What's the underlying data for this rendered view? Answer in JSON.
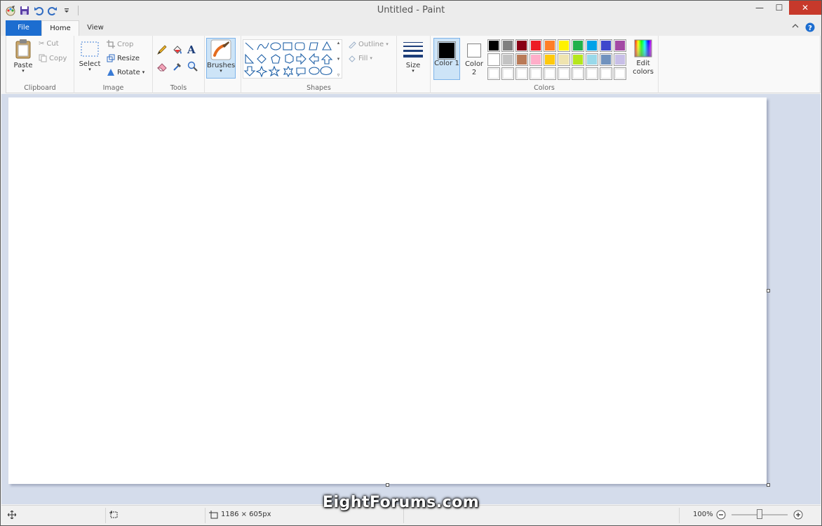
{
  "window": {
    "title": "Untitled - Paint",
    "minimize": "—",
    "maximize": "☐",
    "close": "✕"
  },
  "tabs": [
    "File",
    "Home",
    "View"
  ],
  "help_icons": {
    "collapse": "⌃",
    "help": "?"
  },
  "clipboard": {
    "paste": "Paste",
    "cut": "Cut",
    "copy": "Copy",
    "group": "Clipboard"
  },
  "image": {
    "select": "Select",
    "crop": "Crop",
    "resize": "Resize",
    "rotate": "Rotate",
    "group": "Image"
  },
  "tools": {
    "group": "Tools",
    "text_tool": "A"
  },
  "brushes": {
    "label": "Brushes"
  },
  "shapes": {
    "group": "Shapes",
    "outline": "Outline",
    "fill": "Fill"
  },
  "size": {
    "label": "Size"
  },
  "colors": {
    "color1": "Color 1",
    "color2": "Color 2",
    "edit": "Edit colors",
    "group": "Colors",
    "color1_value": "#000000",
    "color2_value": "#ffffff",
    "row1": [
      "#000000",
      "#7f7f7f",
      "#880015",
      "#ed1c24",
      "#ff7f27",
      "#fff200",
      "#22b14c",
      "#00a2e8",
      "#3f48cc",
      "#a349a4"
    ],
    "row2": [
      "#ffffff",
      "#c3c3c3",
      "#b97a57",
      "#ffaec9",
      "#ffc90e",
      "#efe4b0",
      "#b5e61d",
      "#99d9ea",
      "#7092be",
      "#c8bfe7"
    ],
    "row3": [
      "#ffffff",
      "#ffffff",
      "#ffffff",
      "#ffffff",
      "#ffffff",
      "#ffffff",
      "#ffffff",
      "#ffffff",
      "#ffffff",
      "#ffffff"
    ]
  },
  "status": {
    "image_size": "1186 × 605px",
    "zoom": "100%",
    "zoom_level": 1.0
  },
  "watermark": "EightForums.com"
}
